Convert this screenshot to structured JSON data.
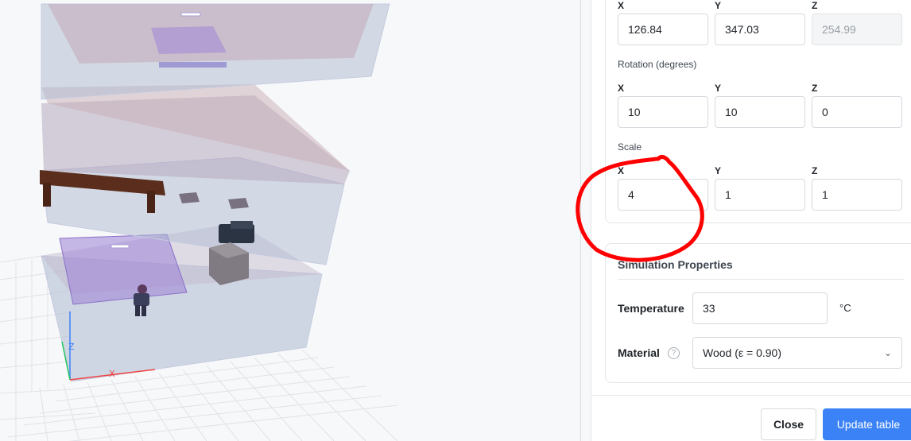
{
  "position": {
    "x_label": "X",
    "y_label": "Y",
    "z_label": "Z",
    "x": "126.84",
    "y": "347.03",
    "z": "254.99"
  },
  "rotation": {
    "title": "Rotation (degrees)",
    "x_label": "X",
    "y_label": "Y",
    "z_label": "Z",
    "x": "10",
    "y": "10",
    "z": "0"
  },
  "scale": {
    "title": "Scale",
    "x_label": "X",
    "y_label": "Y",
    "z_label": "Z",
    "x": "4",
    "y": "1",
    "z": "1"
  },
  "simulation": {
    "title": "Simulation Properties",
    "temperature_label": "Temperature",
    "temperature_value": "33",
    "temperature_unit": "°C",
    "material_label": "Material",
    "material_value": "Wood (ε = 0.90)",
    "help_icon": "question-circle-icon"
  },
  "footer": {
    "close_label": "Close",
    "update_label": "Update table"
  },
  "viewport": {
    "axis_z": "Z",
    "axis_x": "X",
    "colors": {
      "floor_fill": "#aeb9d2",
      "floor_top": "#bfa6b8",
      "zone_purple": "#9b7fd6",
      "table_wood": "#5a2d1c",
      "accent_blue": "#3b82f6",
      "annotation_red": "#ff0000"
    }
  }
}
